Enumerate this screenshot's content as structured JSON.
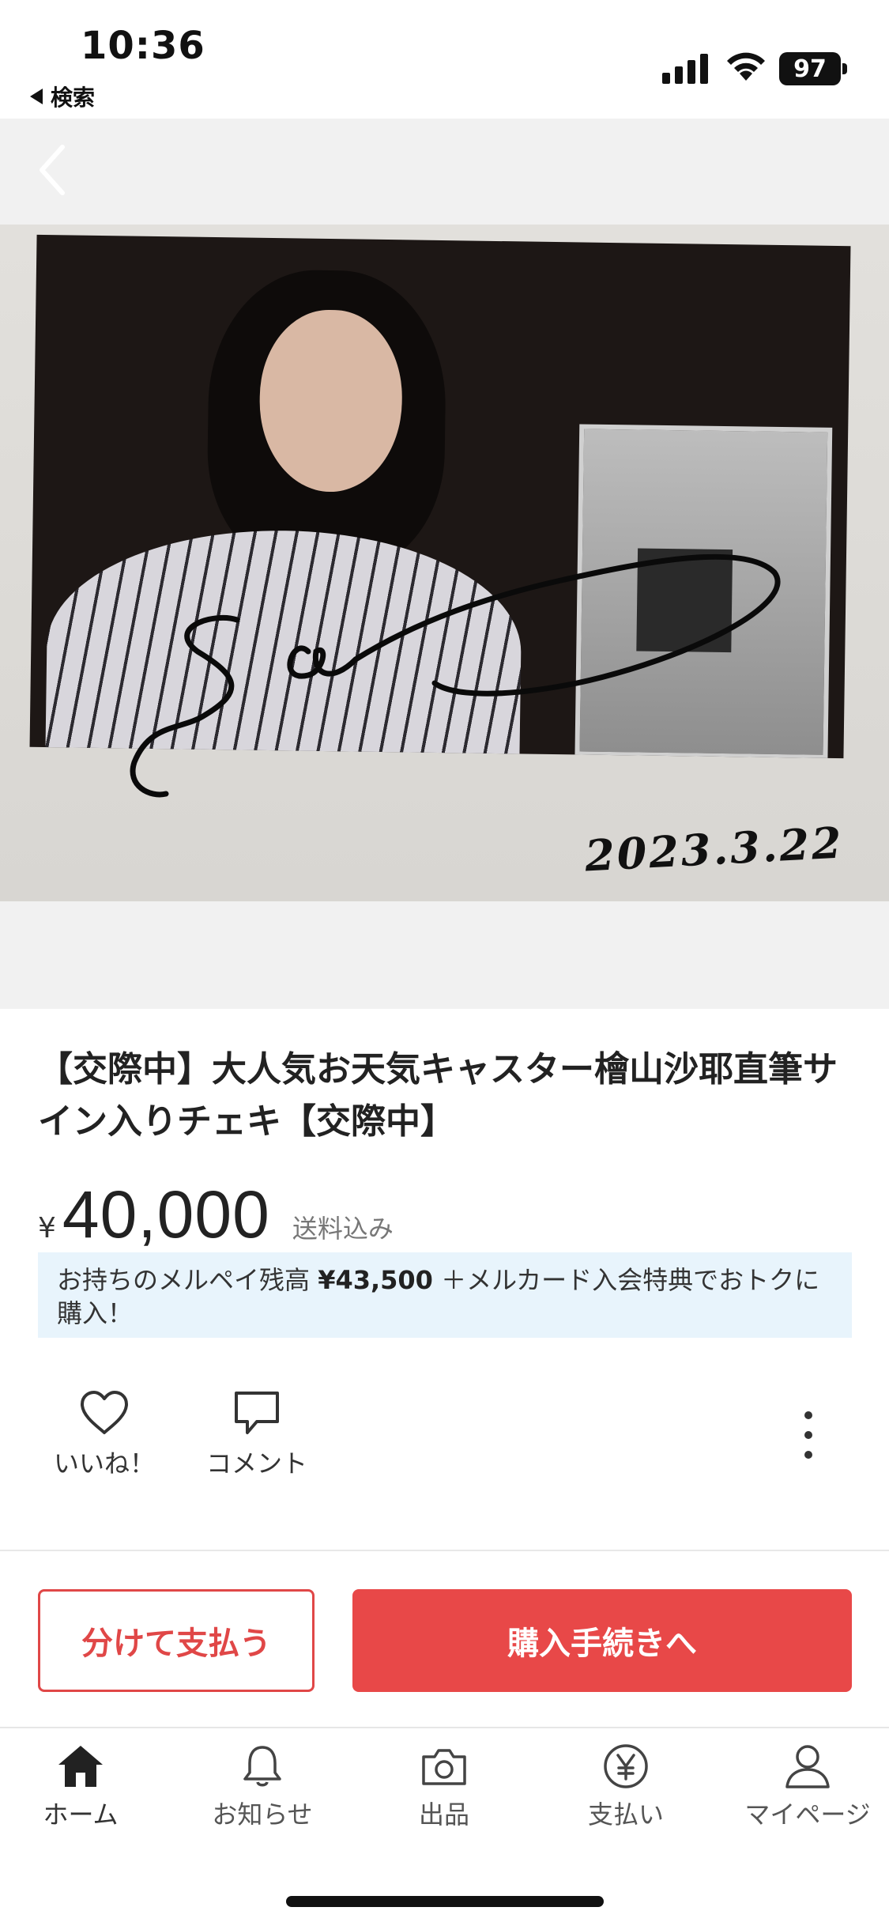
{
  "status_bar": {
    "time": "10:36",
    "back_app_label": "検索",
    "battery": "97"
  },
  "photo": {
    "date_text": "2023.3.22"
  },
  "item": {
    "title": "【交際中】大人気お天気キャスター檜山沙耶直筆サイン入りチェキ【交際中】",
    "currency_symbol": "¥",
    "price": "40,000",
    "shipping": "送料込み",
    "merpay_prefix": "お持ちのメルペイ残高 ",
    "merpay_amount": "¥43,500",
    "merpay_suffix": "＋メルカード入会特典でおトクに購入！"
  },
  "actions": {
    "like_label": "いいね！",
    "comment_label": "コメント"
  },
  "buttons": {
    "split_pay": "分けて支払う",
    "purchase": "購入手続きへ"
  },
  "tab_bar": {
    "items": [
      {
        "label": "ホーム",
        "icon": "home-icon"
      },
      {
        "label": "お知らせ",
        "icon": "bell-icon"
      },
      {
        "label": "出品",
        "icon": "camera-icon"
      },
      {
        "label": "支払い",
        "icon": "yen-circle-icon"
      },
      {
        "label": "マイページ",
        "icon": "person-icon"
      }
    ]
  },
  "colors": {
    "accent": "#e84848",
    "merpay_bg": "#e8f4fc"
  }
}
